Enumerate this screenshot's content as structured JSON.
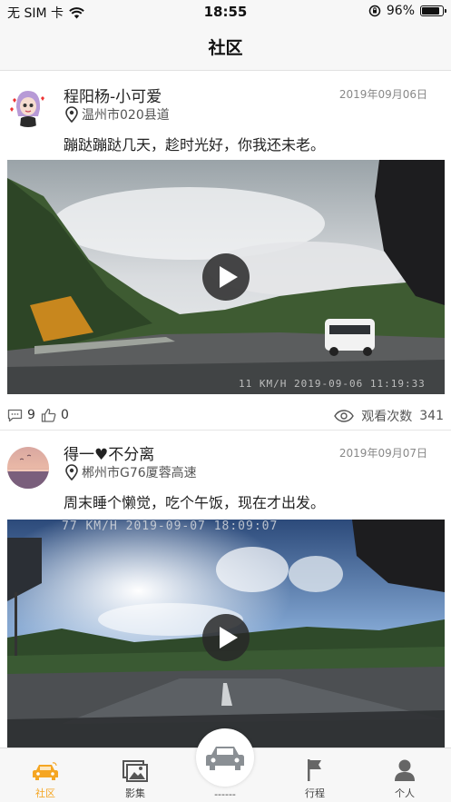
{
  "status_bar": {
    "carrier": "无 SIM 卡",
    "time": "18:55",
    "battery": "96%"
  },
  "nav": {
    "title": "社区"
  },
  "posts": [
    {
      "user": "程阳杨-小可爱",
      "date": "2019年09月06日",
      "location": "温州市020县道",
      "text": "蹦跶蹦跶几天，趁时光好，你我还未老。",
      "video_stamp": "11 KM/H 2019-09-06 11:19:33",
      "comments": "9",
      "likes": "0",
      "views_label": "观看次数",
      "views": "341"
    },
    {
      "user": "得一♥不分离",
      "date": "2019年09月07日",
      "location": "郴州市G76厦蓉高速",
      "text": "周末睡个懒觉，吃个午饭，现在才出发。",
      "video_stamp": "77 KM/H  2019-09-07 18:09:07"
    }
  ],
  "tabs": [
    {
      "label": "社区",
      "icon": "car-icon",
      "active": true
    },
    {
      "label": "影集",
      "icon": "album-icon"
    },
    {
      "label": "------",
      "icon": "car-icon"
    },
    {
      "label": "行程",
      "icon": "flag-icon"
    },
    {
      "label": "个人",
      "icon": "person-icon"
    }
  ],
  "colors": {
    "accent": "#f5a623",
    "nav_bg": "#f7f7f7"
  }
}
